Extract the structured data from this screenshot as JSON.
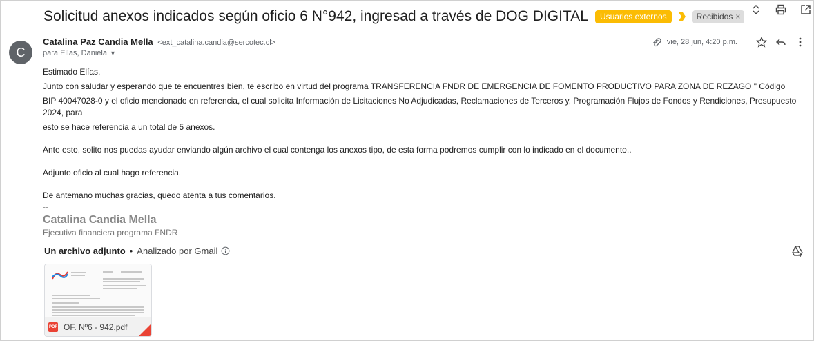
{
  "subject": "Solicitud anexos indicados según oficio 6 N°942, ingresad a través de DOG DIGITAL",
  "labels": {
    "external": "Usuarios externos",
    "inbox": "Recibidos",
    "inbox_close": "×"
  },
  "colors": {
    "external_label": "#fbbc04",
    "importance_marker": "#fbbc04",
    "avatar": "#5f6368",
    "pdf": "#ea4335"
  },
  "sender": {
    "avatar_initial": "C",
    "name": "Catalina Paz Candia Mella",
    "email": "<ext_catalina.candia@sercotec.cl>",
    "recipients": "para Elías, Daniela",
    "date": "vie, 28 jun, 4:20 p.m."
  },
  "body": {
    "greeting": "Estimado Elías,",
    "p1_line1": "Junto con saludar y esperando que te encuentres bien, te escribo en virtud del programa TRANSFERENCIA FNDR DE EMERGENCIA DE FOMENTO PRODUCTIVO PARA ZONA DE REZAGO \" Código",
    "p1_line2": "BIP 40047028-0 y el oficio mencionado en referencia, el cual solicita Información de Licitaciones No Adjudicadas, Reclamaciones de Terceros y, Programación Flujos de Fondos y Rendiciones, Presupuesto 2024, para",
    "p1_line3": "esto se hace referencia a un total de 5 anexos.",
    "p2": "Ante esto, solito nos puedas ayudar enviando algún archivo el cual contenga los anexos tipo, de esta forma podremos cumplir con lo indicado en el documento..",
    "p3": "Adjunto oficio al cual hago referencia.",
    "p4": "De antemano muchas gracias, quedo atenta a tus comentarios.",
    "sig_sep": "--",
    "sig_name": "Catalina Candia Mella",
    "sig_role": "Ejecutiva financiera programa FNDR"
  },
  "attachments": {
    "count_label": "Un archivo adjunto",
    "separator": "•",
    "scanned": "Analizado por Gmail",
    "file_name": "OF. Nº6 - 942.pdf",
    "file_type": "PDF"
  },
  "icons": {
    "expand": "chevrons-up-down-icon",
    "print": "print-icon",
    "open_new": "open-in-new-window-icon",
    "attachment": "paperclip-icon",
    "star": "star-icon",
    "reply": "reply-icon",
    "more": "more-vert-icon",
    "info": "info-icon",
    "add_to_drive": "add-to-drive-icon"
  }
}
